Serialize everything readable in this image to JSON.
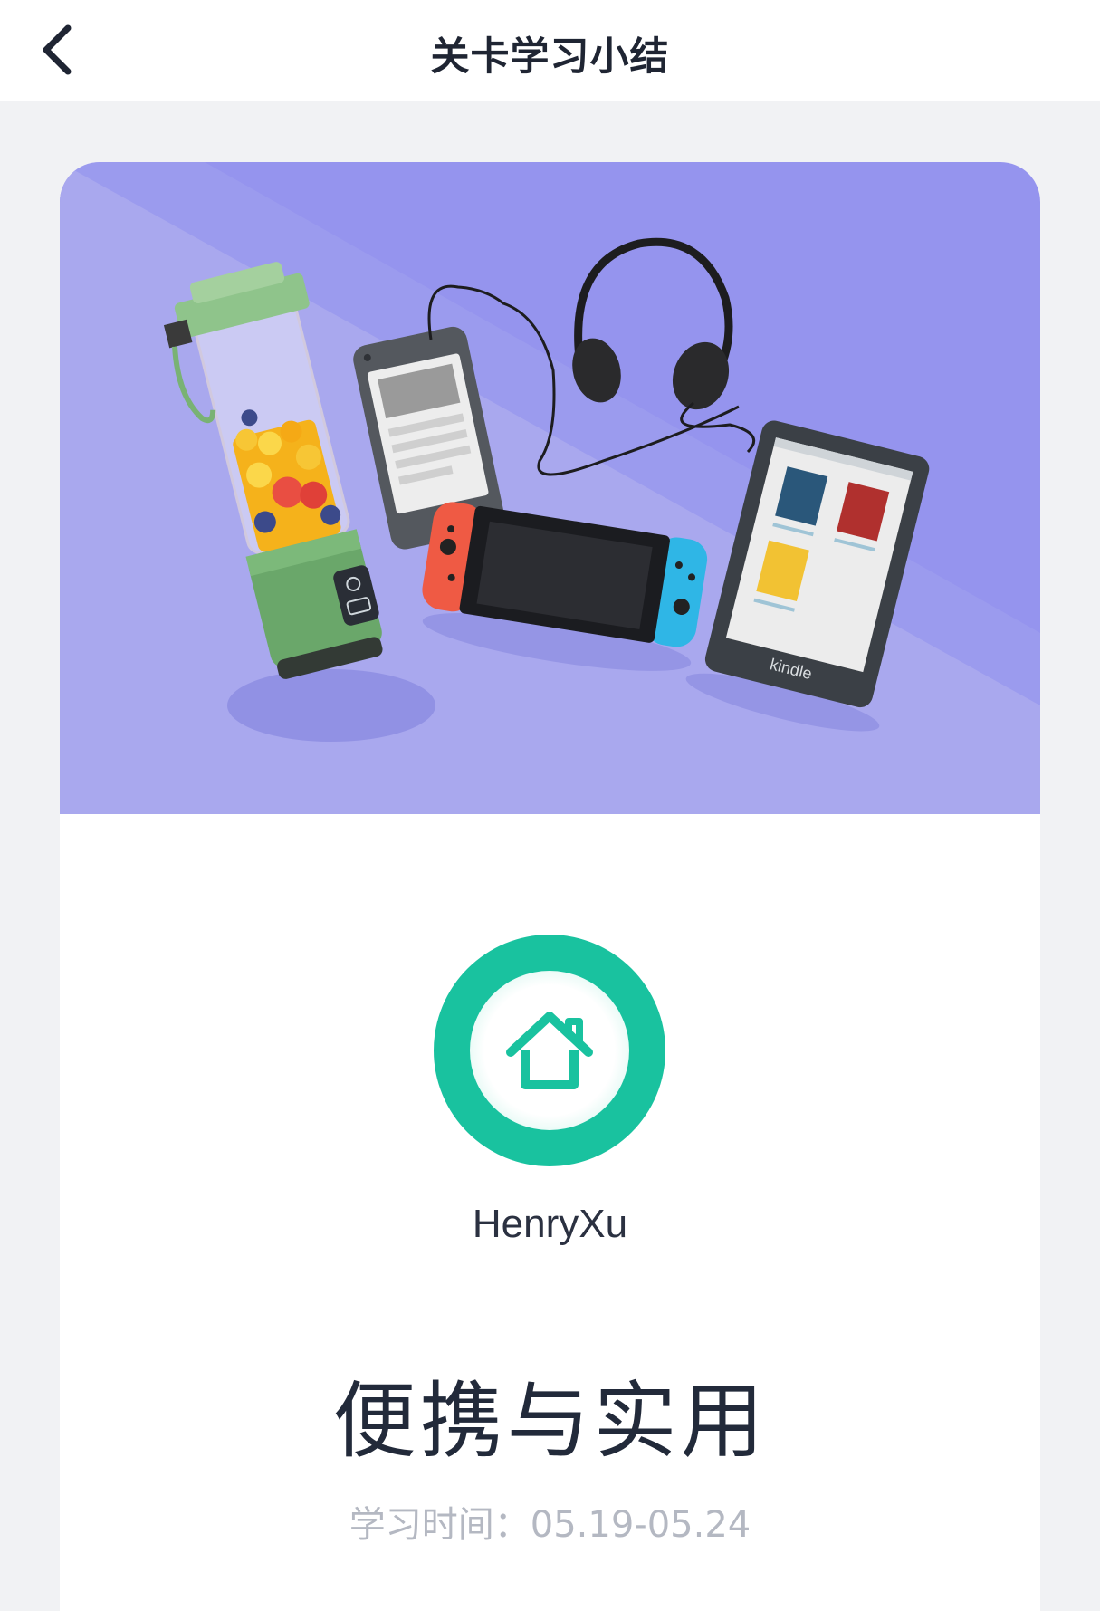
{
  "header": {
    "title": "关卡学习小结",
    "back_icon": "chevron-left-icon"
  },
  "banner": {
    "background_color": "#9594ee",
    "stripe_color": "#a9a8ee",
    "items": [
      "portable-blender",
      "smartphone",
      "headphones",
      "game-console",
      "kindle-ereader"
    ],
    "kindle_label": "kindle"
  },
  "profile": {
    "avatar_icon": "home-icon",
    "avatar_color": "#19c29f",
    "username": "HenryXu"
  },
  "course": {
    "title": "便携与实用",
    "study_time": "学习时间：05.19-05.24"
  }
}
